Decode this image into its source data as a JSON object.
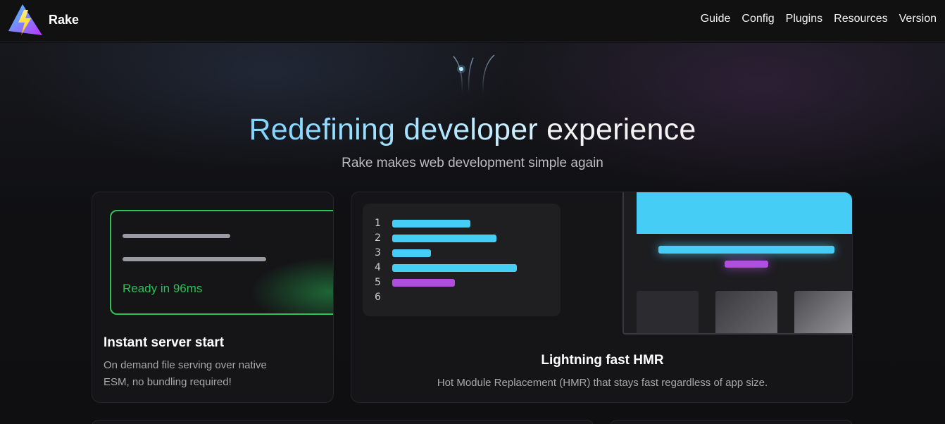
{
  "nav": {
    "brand": "Rake",
    "links": [
      "Guide",
      "Config",
      "Plugins",
      "Resources",
      "Version"
    ]
  },
  "hero": {
    "headline_highlight": "Redefining developer",
    "headline_rest": " experience",
    "subtitle": "Rake makes web development simple again"
  },
  "features": {
    "server": {
      "terminal_text": "Ready in 96ms",
      "title": "Instant server start",
      "description": "On demand file serving over native ESM, no bundling required!"
    },
    "hmr": {
      "line_numbers": [
        "1",
        "2",
        "3",
        "4",
        "5",
        "6"
      ],
      "title": "Lightning fast HMR",
      "description": "Hot Module Replacement (HMR) that stays fast regardless of app size."
    }
  },
  "colors": {
    "accent_blue": "#46cdf6",
    "accent_purple": "#b14ee0",
    "accent_green": "#2dbf57"
  },
  "icons": {
    "logo": "rake-logo-icon",
    "hero_decoration": "spark-icon"
  }
}
